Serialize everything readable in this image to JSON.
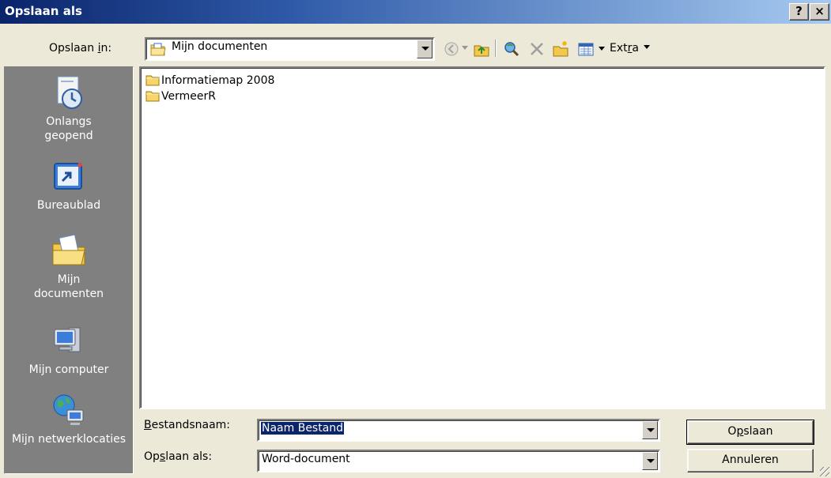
{
  "window": {
    "title": "Opslaan als",
    "help_label": "?",
    "close_label": "×"
  },
  "toolbar": {
    "save_in_label": "Opslaan in:",
    "save_in_value": "Mijn documenten",
    "extra_label": "Extra",
    "icons": [
      "back-icon",
      "up-folder-icon",
      "search-web-icon",
      "delete-icon",
      "new-folder-icon",
      "views-icon"
    ]
  },
  "places": [
    {
      "label": "Onlangs geopend",
      "icon": "recent-documents-icon"
    },
    {
      "label": "Bureaublad",
      "icon": "desktop-icon"
    },
    {
      "label": "Mijn documenten",
      "icon": "my-documents-icon"
    },
    {
      "label": "Mijn computer",
      "icon": "my-computer-icon"
    },
    {
      "label": "Mijn netwerklocaties",
      "icon": "network-places-icon"
    }
  ],
  "files": [
    {
      "name": "Informatiemap 2008",
      "icon": "folder-icon"
    },
    {
      "name": "VermeerR",
      "icon": "folder-icon"
    }
  ],
  "form": {
    "filename_label": "Bestandsnaam:",
    "filename_value": "Naam Bestand",
    "filetype_label": "Opslaan als:",
    "filetype_value": "Word-document"
  },
  "buttons": {
    "save": "Opslaan",
    "cancel": "Annuleren"
  },
  "colors": {
    "titlebar_start": "#0a246a",
    "titlebar_end": "#a6caf0",
    "dialog_bg": "#ece9d8",
    "places_bg": "#808080",
    "selection": "#0a246a"
  }
}
